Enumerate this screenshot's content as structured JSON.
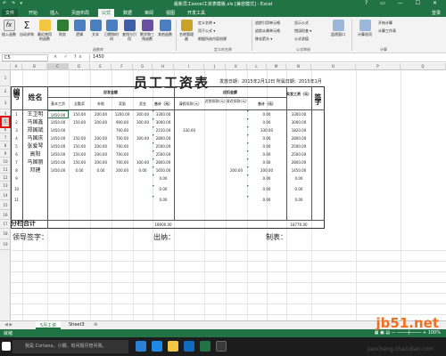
{
  "window": {
    "title": "最新员工excel工资表模板.xls  [兼容模式] - Excel",
    "quick_access": "↶ ↷ ▾",
    "controls": "?  ▭  —  ☐  ✕"
  },
  "ribbon": {
    "tabs": [
      "文件",
      "开始",
      "插入",
      "页面布局",
      "公式",
      "数据",
      "审阅",
      "视图",
      "开发工具"
    ],
    "active_tab": "公式",
    "login": "登录",
    "buttons": [
      {
        "label": "插入函数",
        "icon": "fx-icon"
      },
      {
        "label": "自动求和",
        "icon": "sum-icon"
      },
      {
        "label": "最近使用的函数",
        "icon": "star-icon"
      },
      {
        "label": "财务",
        "icon": "book-icon"
      },
      {
        "label": "逻辑",
        "icon": "question-icon"
      },
      {
        "label": "文本",
        "icon": "text-icon"
      },
      {
        "label": "日期和时间",
        "icon": "clock-icon"
      },
      {
        "label": "查找与引用",
        "icon": "search-icon"
      },
      {
        "label": "数学和三角函数",
        "icon": "theta-icon"
      },
      {
        "label": "其他函数",
        "icon": "more-icon"
      },
      {
        "label": "名称管理器",
        "icon": "tag-icon"
      }
    ],
    "define_names": [
      "定义名称 ▾",
      "用于公式 ▾",
      "根据所选内容创建"
    ],
    "audit": [
      "追踪引用单元格",
      "追踪从属单元格",
      "移去箭头 ▾",
      "显示公式",
      "错误检查 ▾",
      "公式求值"
    ],
    "watch": "监视窗口",
    "calc": [
      "计算选项",
      "开始计算",
      "计算工作表"
    ],
    "groups": [
      "函数库",
      "定义的名称",
      "公式审核",
      "计算"
    ]
  },
  "formula_bar": {
    "name_box": "C5",
    "icons": "× ✓ fx",
    "value": "1450"
  },
  "columns": [
    "A",
    "B",
    "C",
    "D",
    "E",
    "F",
    "G",
    "H",
    "I",
    "J",
    "K",
    "L",
    "M",
    "N",
    "O",
    "P",
    "Q"
  ],
  "selected_column": "C",
  "rows": [
    "1",
    "2",
    "3",
    "4",
    "5",
    "6",
    "7",
    "8",
    "9",
    "10",
    "11",
    "12",
    "13",
    "14",
    "15",
    "16",
    "17",
    "18",
    "19"
  ],
  "selected_row": "5",
  "sheet": {
    "title": "员工工资表",
    "date_text": "发放日期：2015年2月12日   所属日期：2015年1月",
    "col_number": "编号",
    "col_name": "姓名",
    "group_payable": "应发金额",
    "group_deduct": "应扣金额",
    "col_actual": "实发工资（元）",
    "col_sign": "签字",
    "sub_headers": [
      "基本工资",
      "全勤奖",
      "补助",
      "奖励",
      "奖金",
      "合计（元）",
      "请假扣款(元)",
      "迟到扣款(元)",
      "滞迟扣款(元)",
      "合计（元）"
    ],
    "rows": [
      {
        "no": "1",
        "name": "王卫明",
        "vals": [
          "1450.00",
          "150.00",
          "200.00",
          "1200.00",
          "300.00",
          "3300.00",
          "",
          "",
          "",
          "0.00",
          "3300.00"
        ]
      },
      {
        "no": "2",
        "name": "马国鑫",
        "vals": [
          "1450.00",
          "150.00",
          "200.00",
          "900.00",
          "300.00",
          "3000.00",
          "",
          "",
          "",
          "0.00",
          "3000.00"
        ]
      },
      {
        "no": "3",
        "name": "郑国斌",
        "vals": [
          "1450.00",
          "",
          "",
          "700.00",
          "",
          "2150.00",
          "330.00",
          "",
          "",
          "330.00",
          "1820.00"
        ]
      },
      {
        "no": "4",
        "name": "马国庆",
        "vals": [
          "1450.00",
          "150.00",
          "200.00",
          "700.00",
          "300.00",
          "2800.00",
          "",
          "",
          "",
          "0.00",
          "2800.00"
        ]
      },
      {
        "no": "5",
        "name": "张爱琴",
        "vals": [
          "1450.00",
          "150.00",
          "200.00",
          "700.00",
          "",
          "2500.00",
          "",
          "",
          "",
          "0.00",
          "2500.00"
        ]
      },
      {
        "no": "6",
        "name": "高阳",
        "vals": [
          "1450.00",
          "150.00",
          "200.00",
          "700.00",
          "",
          "2500.00",
          "",
          "",
          "",
          "0.00",
          "2500.00"
        ]
      },
      {
        "no": "7",
        "name": "马国丽",
        "vals": [
          "1450.00",
          "150.00",
          "200.00",
          "700.00",
          "300.00",
          "2800.00",
          "",
          "",
          "",
          "0.00",
          "2800.00"
        ]
      },
      {
        "no": "8",
        "name": "邓建",
        "vals": [
          "1450.00",
          "0.00",
          "0.00",
          "200.00",
          "0.00",
          "1650.00",
          "",
          "",
          "200.00",
          "200.00",
          "1450.00"
        ]
      },
      {
        "no": "9",
        "name": "",
        "vals": [
          "",
          "",
          "",
          "",
          "",
          "0.00",
          "",
          "",
          "",
          "0.00",
          "0.00"
        ]
      },
      {
        "no": "10",
        "name": "",
        "vals": [
          "",
          "",
          "",
          "",
          "",
          "0.00",
          "",
          "",
          "",
          "0.00",
          "0.00"
        ]
      },
      {
        "no": "11",
        "name": "",
        "vals": [
          "",
          "",
          "",
          "",
          "",
          "0.00",
          "",
          "",
          "",
          "0.00",
          "0.00"
        ]
      }
    ],
    "subtotal_label": "分栏合计",
    "subtotal_payable": "18900.00",
    "subtotal_actual": "18770.00",
    "footer_leader": "领导签字：",
    "footer_cashier": "出纳：",
    "footer_maker": "制表："
  },
  "sheet_tabs": [
    "5月工资",
    "Sheet3",
    "⊕"
  ],
  "active_sheet": "5月工资",
  "status": {
    "left": "就绪",
    "right": "▦  ▣  ▤   —  ────┼────  +  100%"
  },
  "taskbar": {
    "search": "我是 Cortana，小娜。有问题尽管问我。"
  },
  "watermark": {
    "main": "jb51.net",
    "sub": "jiaocheng.chazidian.com"
  }
}
